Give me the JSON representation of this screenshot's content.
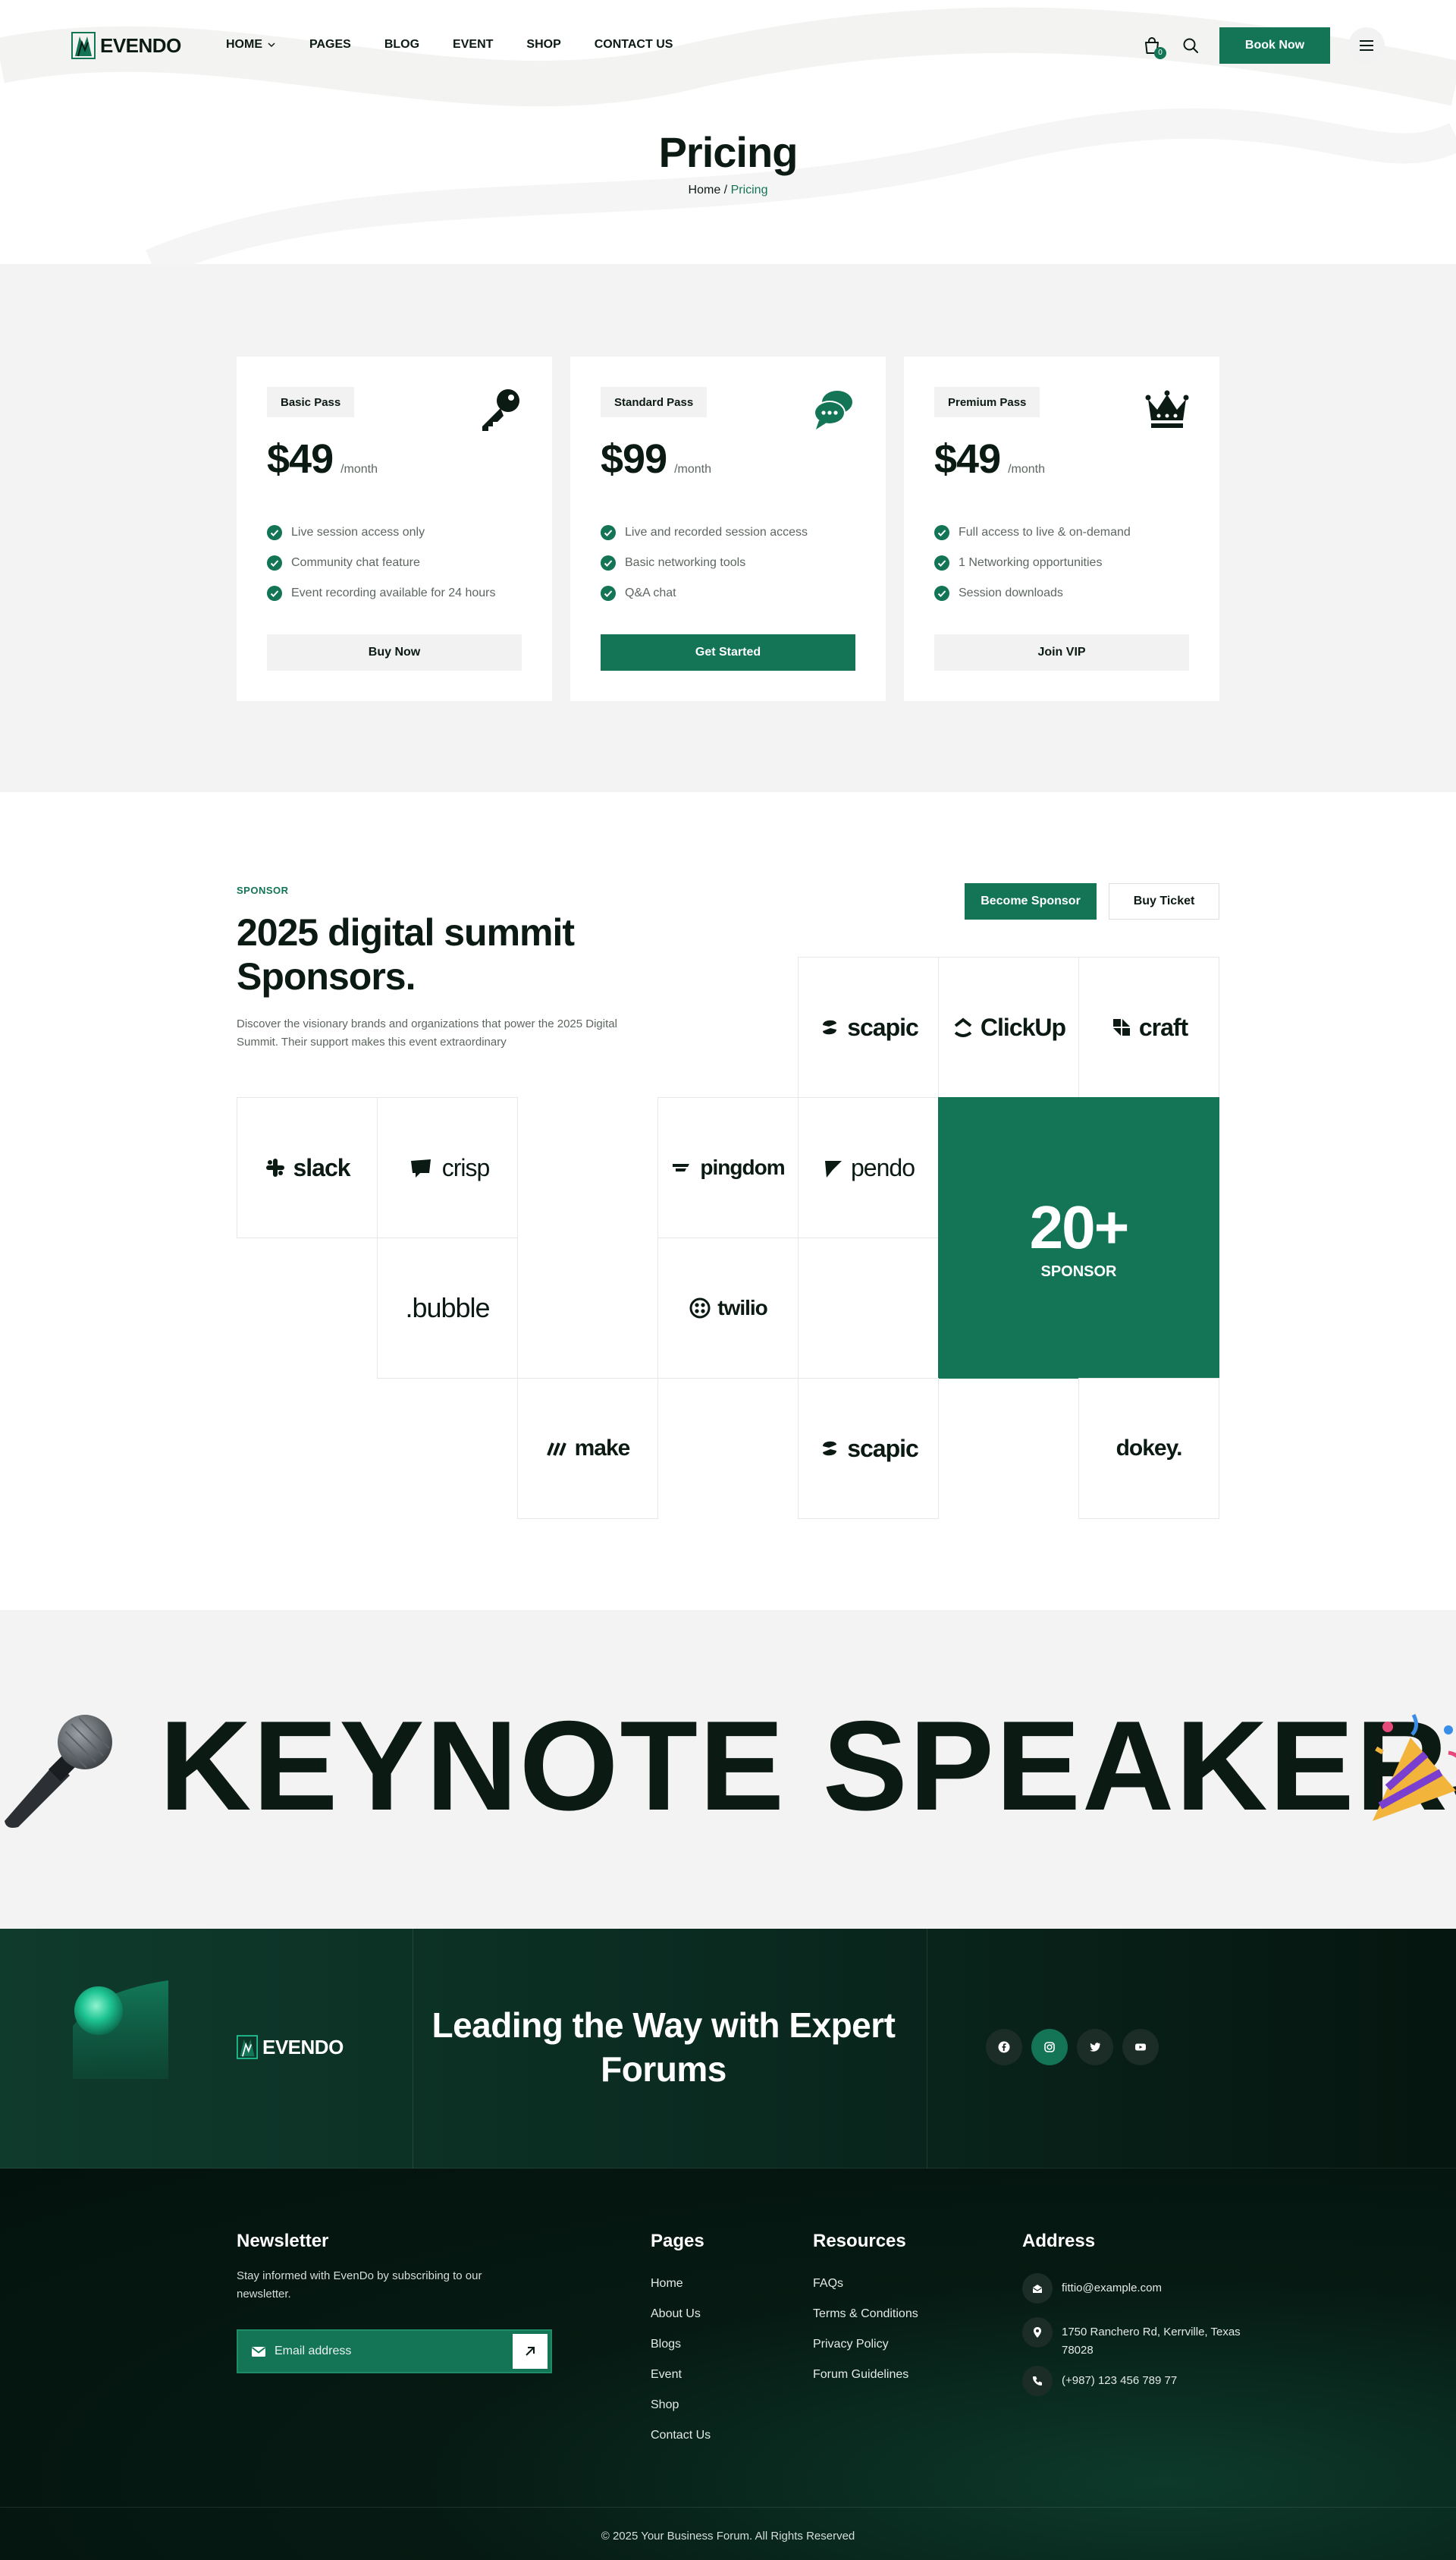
{
  "brand": {
    "name": "EVENDO",
    "accent": "#137456",
    "dark": "#0c1a14"
  },
  "nav": {
    "items": [
      "HOME",
      "PAGES",
      "BLOG",
      "EVENT",
      "SHOP",
      "CONTACT US"
    ],
    "cart_count": "0",
    "book_label": "Book Now"
  },
  "hero": {
    "title": "Pricing",
    "crumb_home": "Home",
    "crumb_sep": " / ",
    "crumb_current": "Pricing"
  },
  "pricing": {
    "plans": [
      {
        "tag": "Basic Pass",
        "icon": "key-icon",
        "price": "$49",
        "period": "/month",
        "features": [
          "Live session access only",
          "Community chat feature",
          "Event recording available for 24 hours"
        ],
        "button": "Buy Now"
      },
      {
        "tag": "Standard Pass",
        "icon": "chat-bubbles-icon",
        "price": "$99",
        "period": "/month",
        "features": [
          "Live and recorded session access",
          "Basic networking tools",
          "Q&A chat"
        ],
        "button": "Get Started"
      },
      {
        "tag": "Premium Pass",
        "icon": "crown-icon",
        "price": "$49",
        "period": "/month",
        "features": [
          "Full access to live & on-demand",
          "1 Networking opportunities",
          "Session downloads"
        ],
        "button": "Join VIP"
      }
    ]
  },
  "sponsors": {
    "kicker": "SPONSOR",
    "title": "2025 digital summit Sponsors.",
    "description": "Discover the visionary brands and organizations that power the 2025 Digital Summit. Their support makes this event extraordinary",
    "become_label": "Become Sponsor",
    "ticket_label": "Buy Ticket",
    "logos": [
      "scapic",
      "ClickUp",
      "craft",
      "slack",
      "crisp",
      "pingdom",
      "pendo",
      ".bubble",
      "twilio",
      "make",
      "scapic",
      "dokey."
    ],
    "count": "20+",
    "count_label": "SPONSOR"
  },
  "keynote": {
    "text": "KEYNOTE SPEAKERS"
  },
  "footer_top": {
    "brand": "EVENDO",
    "tagline": "Leading the Way with Expert Forums",
    "socials": [
      "facebook-icon",
      "instagram-icon",
      "twitter-icon",
      "youtube-icon"
    ]
  },
  "footer": {
    "newsletter": {
      "heading": "Newsletter",
      "text": "Stay informed with EvenDo by subscribing to our newsletter.",
      "placeholder": "Email address"
    },
    "pages": {
      "heading": "Pages",
      "links": [
        "Home",
        "About Us",
        "Blogs",
        "Event",
        "Shop",
        "Contact Us"
      ]
    },
    "resources": {
      "heading": "Resources",
      "links": [
        "FAQs",
        "Terms & Conditions",
        "Privacy Policy",
        "Forum Guidelines"
      ]
    },
    "address": {
      "heading": "Address",
      "email": "fittio@example.com",
      "street": "1750 Ranchero Rd, Kerrville, Texas 78028",
      "phone": "(+987) 123 456 789 77"
    },
    "copyright": "© 2025 Your Business Forum. All Rights Reserved"
  }
}
